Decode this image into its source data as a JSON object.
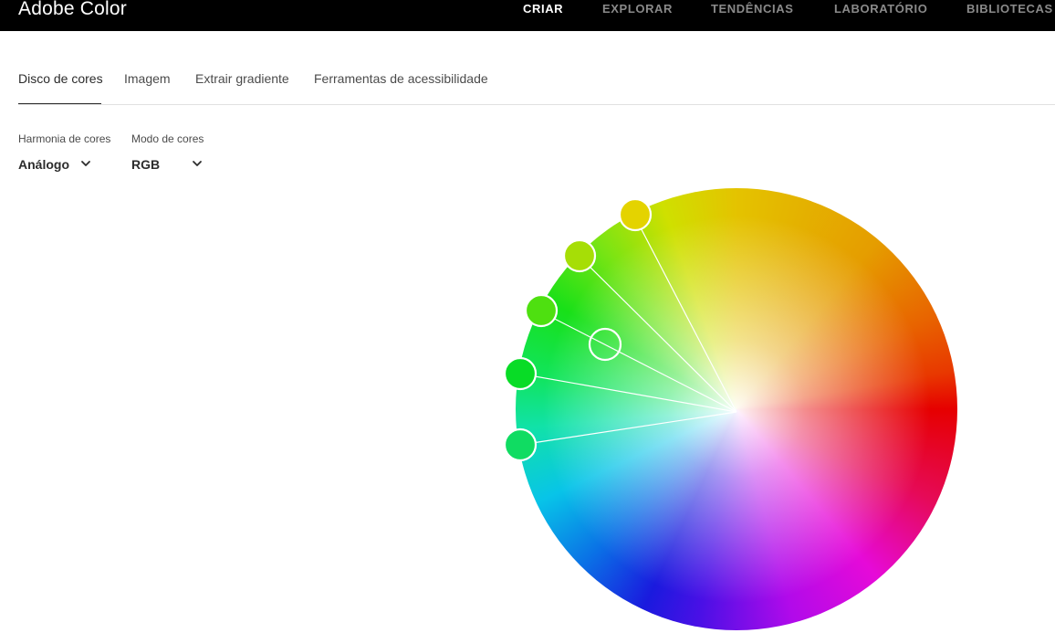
{
  "app": {
    "title": "Adobe Color"
  },
  "topnav": {
    "items": [
      {
        "label": "CRIAR",
        "active": true
      },
      {
        "label": "EXPLORAR",
        "active": false
      },
      {
        "label": "TENDÊNCIAS",
        "active": false
      },
      {
        "label": "LABORATÓRIO",
        "active": false
      },
      {
        "label": "BIBLIOTECAS",
        "active": false
      }
    ]
  },
  "tabs": {
    "items": [
      {
        "label": "Disco de cores",
        "active": true
      },
      {
        "label": "Imagem",
        "active": false
      },
      {
        "label": "Extrair gradiente",
        "active": false
      },
      {
        "label": "Ferramentas de acessibilidade",
        "active": false
      }
    ]
  },
  "controls": {
    "harmony": {
      "label": "Harmonia de cores",
      "value": "Análogo"
    },
    "mode": {
      "label": "Modo de cores",
      "value": "RGB"
    }
  },
  "wheel": {
    "handles": [
      {
        "color": "#e4d300"
      },
      {
        "color": "#a6de06"
      },
      {
        "color": "#4ee010"
      },
      {
        "color": "#08dc26"
      },
      {
        "color": "#10dc62"
      }
    ],
    "base_marker": {
      "color": "transparent"
    }
  },
  "theme": {
    "topbar_bg": "#000000",
    "active_nav": "#ffffff",
    "inactive_nav": "#8a8a8a",
    "text": "#2c2c2c"
  }
}
